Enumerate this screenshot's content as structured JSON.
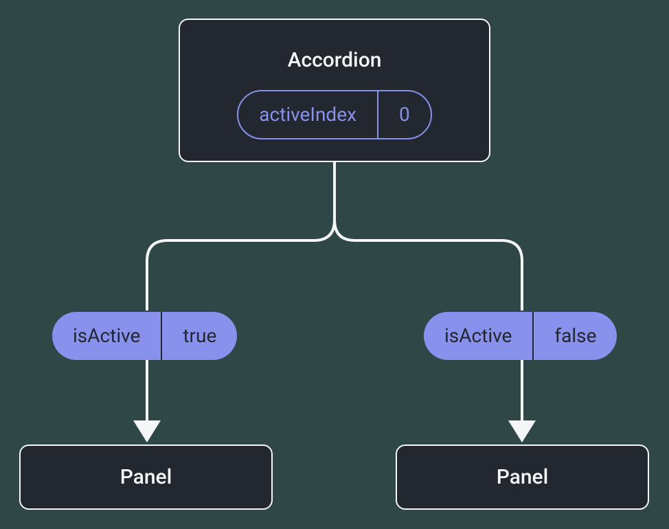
{
  "diagram": {
    "root": {
      "title": "Accordion",
      "state": {
        "key": "activeIndex",
        "value": "0"
      }
    },
    "children": [
      {
        "prop": {
          "key": "isActive",
          "value": "true"
        },
        "panel": {
          "title": "Panel"
        }
      },
      {
        "prop": {
          "key": "isActive",
          "value": "false"
        },
        "panel": {
          "title": "Panel"
        }
      }
    ]
  },
  "colors": {
    "background": "#2f4747",
    "nodeFill": "#23272f",
    "nodeBorder": "#f5f6f7",
    "accent": "#8891ec",
    "textOnAccent": "#23272f"
  }
}
